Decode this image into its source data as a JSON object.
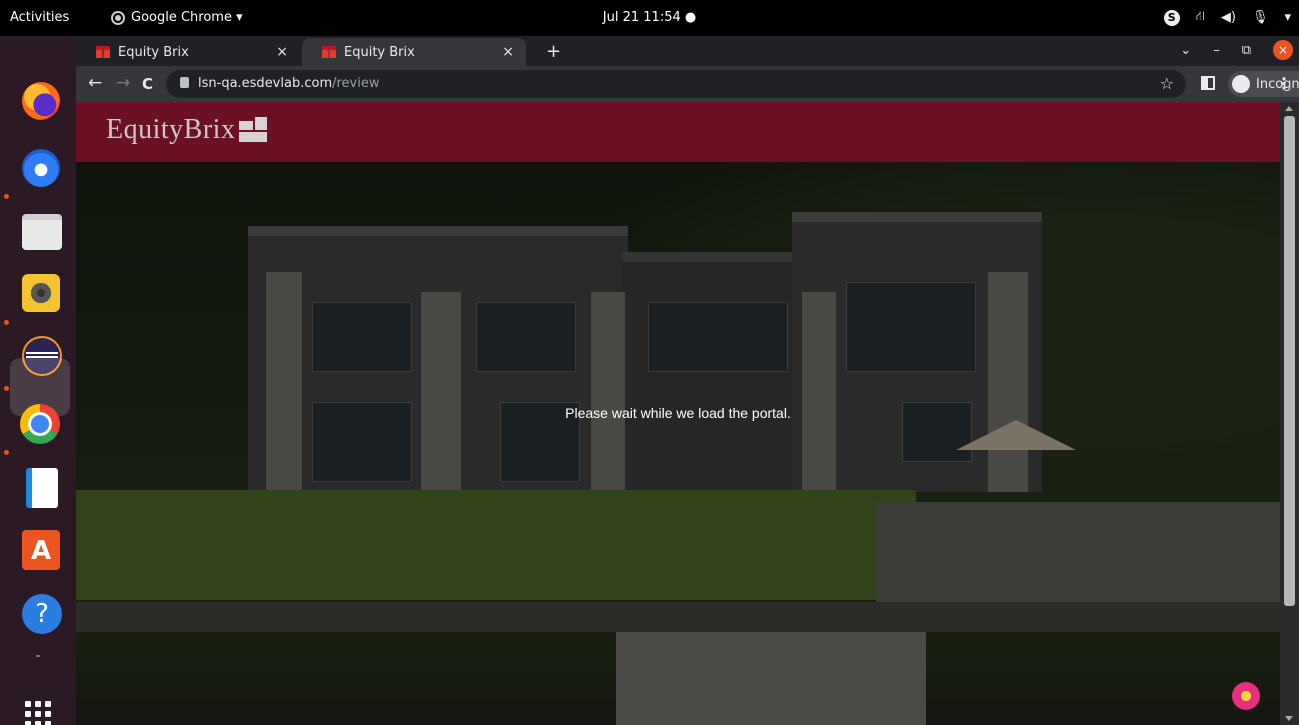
{
  "topbar": {
    "activities": "Activities",
    "app_name": "Google Chrome ▾",
    "clock": "Jul 21  11:54  ●",
    "skype": "S",
    "status_icons": [
      "⛙",
      "◀)",
      "🎙",
      "▾"
    ]
  },
  "dock": {
    "apps": [
      "firefox-icon",
      "thunderbird-icon",
      "files-icon",
      "rhythmbox-icon",
      "eclipse-icon",
      "chrome-icon",
      "writer-icon",
      "software-store-icon",
      "help-icon",
      "show-apps-icon"
    ],
    "store_glyph": "A",
    "help_glyph": "?"
  },
  "browser": {
    "tabs": [
      {
        "title": "Equity Brix",
        "close": "×"
      },
      {
        "title": "Equity Brix",
        "close": "×"
      }
    ],
    "new_tab": "+",
    "window_controls": {
      "dropdown": "⌄",
      "minimize": "–",
      "restore": "⧉",
      "close": "×"
    },
    "nav": {
      "back": "←",
      "forward": "→",
      "reload": "C"
    },
    "url_host": "lsn-qa.esdevlab.com",
    "url_path": "/review",
    "bookmark": "☆",
    "incognito_label": "Incognito",
    "menu": "⋮"
  },
  "page": {
    "logo_text": "EquityBrix",
    "loading_message": "Please wait while we load the portal."
  },
  "colors": {
    "header_bg": "#6b1123",
    "dock_bg": "#2b1a24",
    "accent_orange": "#e95420"
  }
}
